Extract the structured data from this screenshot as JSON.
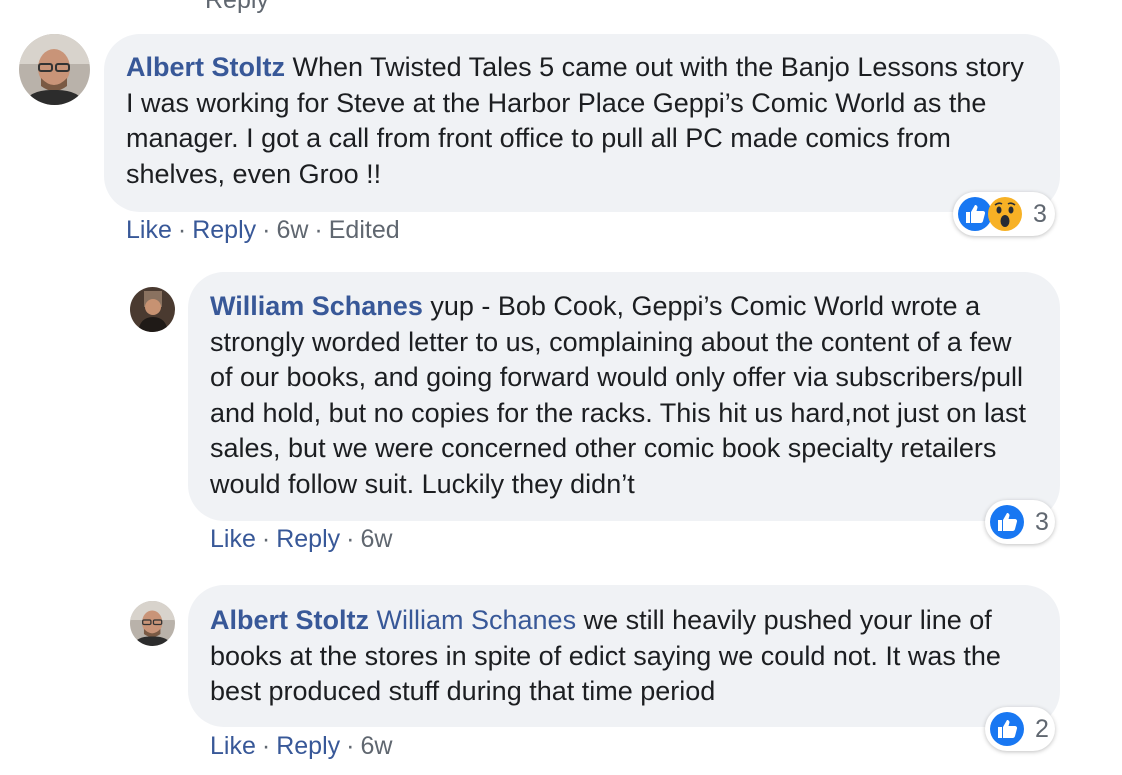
{
  "top_partial_action": "Reply",
  "comments": [
    {
      "author": "Albert Stoltz",
      "text": "When Twisted Tales 5 came out with the Banjo Lessons story I was working for Steve at the Harbor Place Geppi’s Comic World as the manager. I got a call from front office to pull all PC made comics from shelves, even Groo !!",
      "like_label": "Like",
      "reply_label": "Reply",
      "time": "6w",
      "edited": "Edited",
      "reactions": [
        "like-icon",
        "wow-icon"
      ],
      "reaction_count": "3"
    },
    {
      "author": "William Schanes",
      "text": "yup - Bob Cook, Geppi’s Comic World wrote a strongly worded letter to us, complaining about the content of a few of our books, and going forward would only offer via subscribers/pull and hold, but no copies for the racks. This hit us hard,not just on last sales, but we were concerned other comic book specialty retailers would follow suit. Luckily they didn’t",
      "like_label": "Like",
      "reply_label": "Reply",
      "time": "6w",
      "reactions": [
        "like-icon"
      ],
      "reaction_count": "3"
    },
    {
      "author": "Albert Stoltz",
      "mention": "William Schanes",
      "text": "we still heavily pushed your line of books at the stores in spite of edict saying we could not. It was the best produced stuff during that time period",
      "like_label": "Like",
      "reply_label": "Reply",
      "time": "6w",
      "reactions": [
        "like-icon"
      ],
      "reaction_count": "2"
    }
  ],
  "colors": {
    "author": "#385898",
    "bubble": "#f0f2f5",
    "meta": "#606770",
    "like_blue": "#1877f2",
    "wow_yellow": "#f7b125"
  }
}
